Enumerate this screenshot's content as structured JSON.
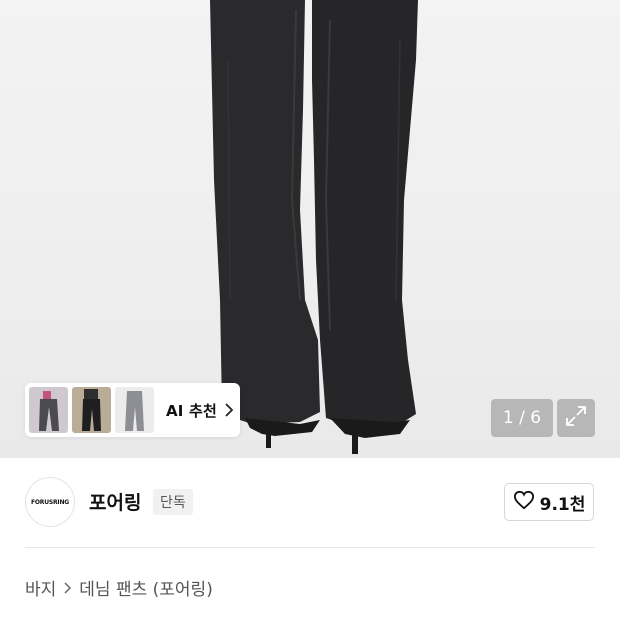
{
  "gallery": {
    "counter": "1 / 6",
    "ai_recommend_label": "AI 추천",
    "thumbnails": [
      "thumbnail-1",
      "thumbnail-2",
      "thumbnail-3"
    ]
  },
  "brand": {
    "logo_text": "FORUSRING",
    "name": "포어링",
    "badge": "단독"
  },
  "like": {
    "count": "9.1천"
  },
  "breadcrumb": {
    "category": "바지",
    "subcategory": "데님 팬츠 (포어링)"
  },
  "colors": {
    "denim": "#2a2a2c",
    "counter_bg": "#8c8c8c",
    "badge_bg": "#f1f1f1"
  }
}
